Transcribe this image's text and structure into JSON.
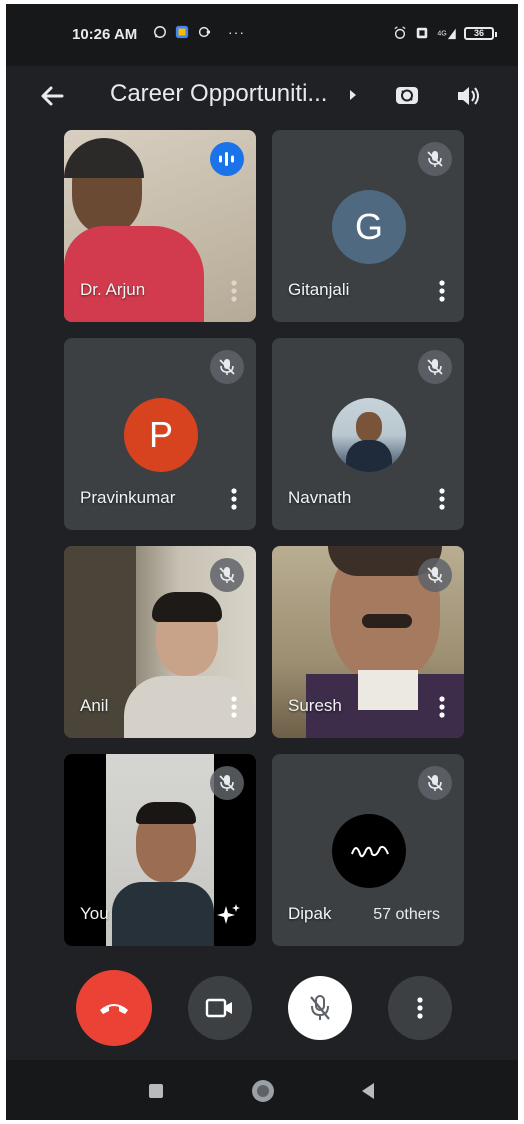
{
  "status_bar": {
    "time": "10:26 AM",
    "battery": "36"
  },
  "header": {
    "title": "Career Opportuniti..."
  },
  "participants": [
    {
      "name": "Dr. Arjun",
      "type": "video",
      "speaking": true
    },
    {
      "name": "Gitanjali",
      "type": "avatar",
      "initial": "G",
      "avatar_color": "#4f6a80"
    },
    {
      "name": "Pravinkumar",
      "type": "avatar",
      "initial": "P",
      "avatar_color": "#d7431f"
    },
    {
      "name": "Navnath",
      "type": "photo"
    },
    {
      "name": "Anil",
      "type": "video"
    },
    {
      "name": "Suresh",
      "type": "video"
    },
    {
      "name": "You",
      "type": "video"
    },
    {
      "name": "Dipak",
      "type": "logo",
      "others_label": "57 others"
    }
  ],
  "colors": {
    "end_call": "#ea4335",
    "background": "#202124",
    "tile": "#3c4043",
    "speaking": "#1a73e8"
  },
  "controls": {
    "end_call_icon": "phone-hangup-icon",
    "camera_icon": "video-camera-icon",
    "mic_icon": "mic-off-icon",
    "more_icon": "more-vertical-icon"
  }
}
